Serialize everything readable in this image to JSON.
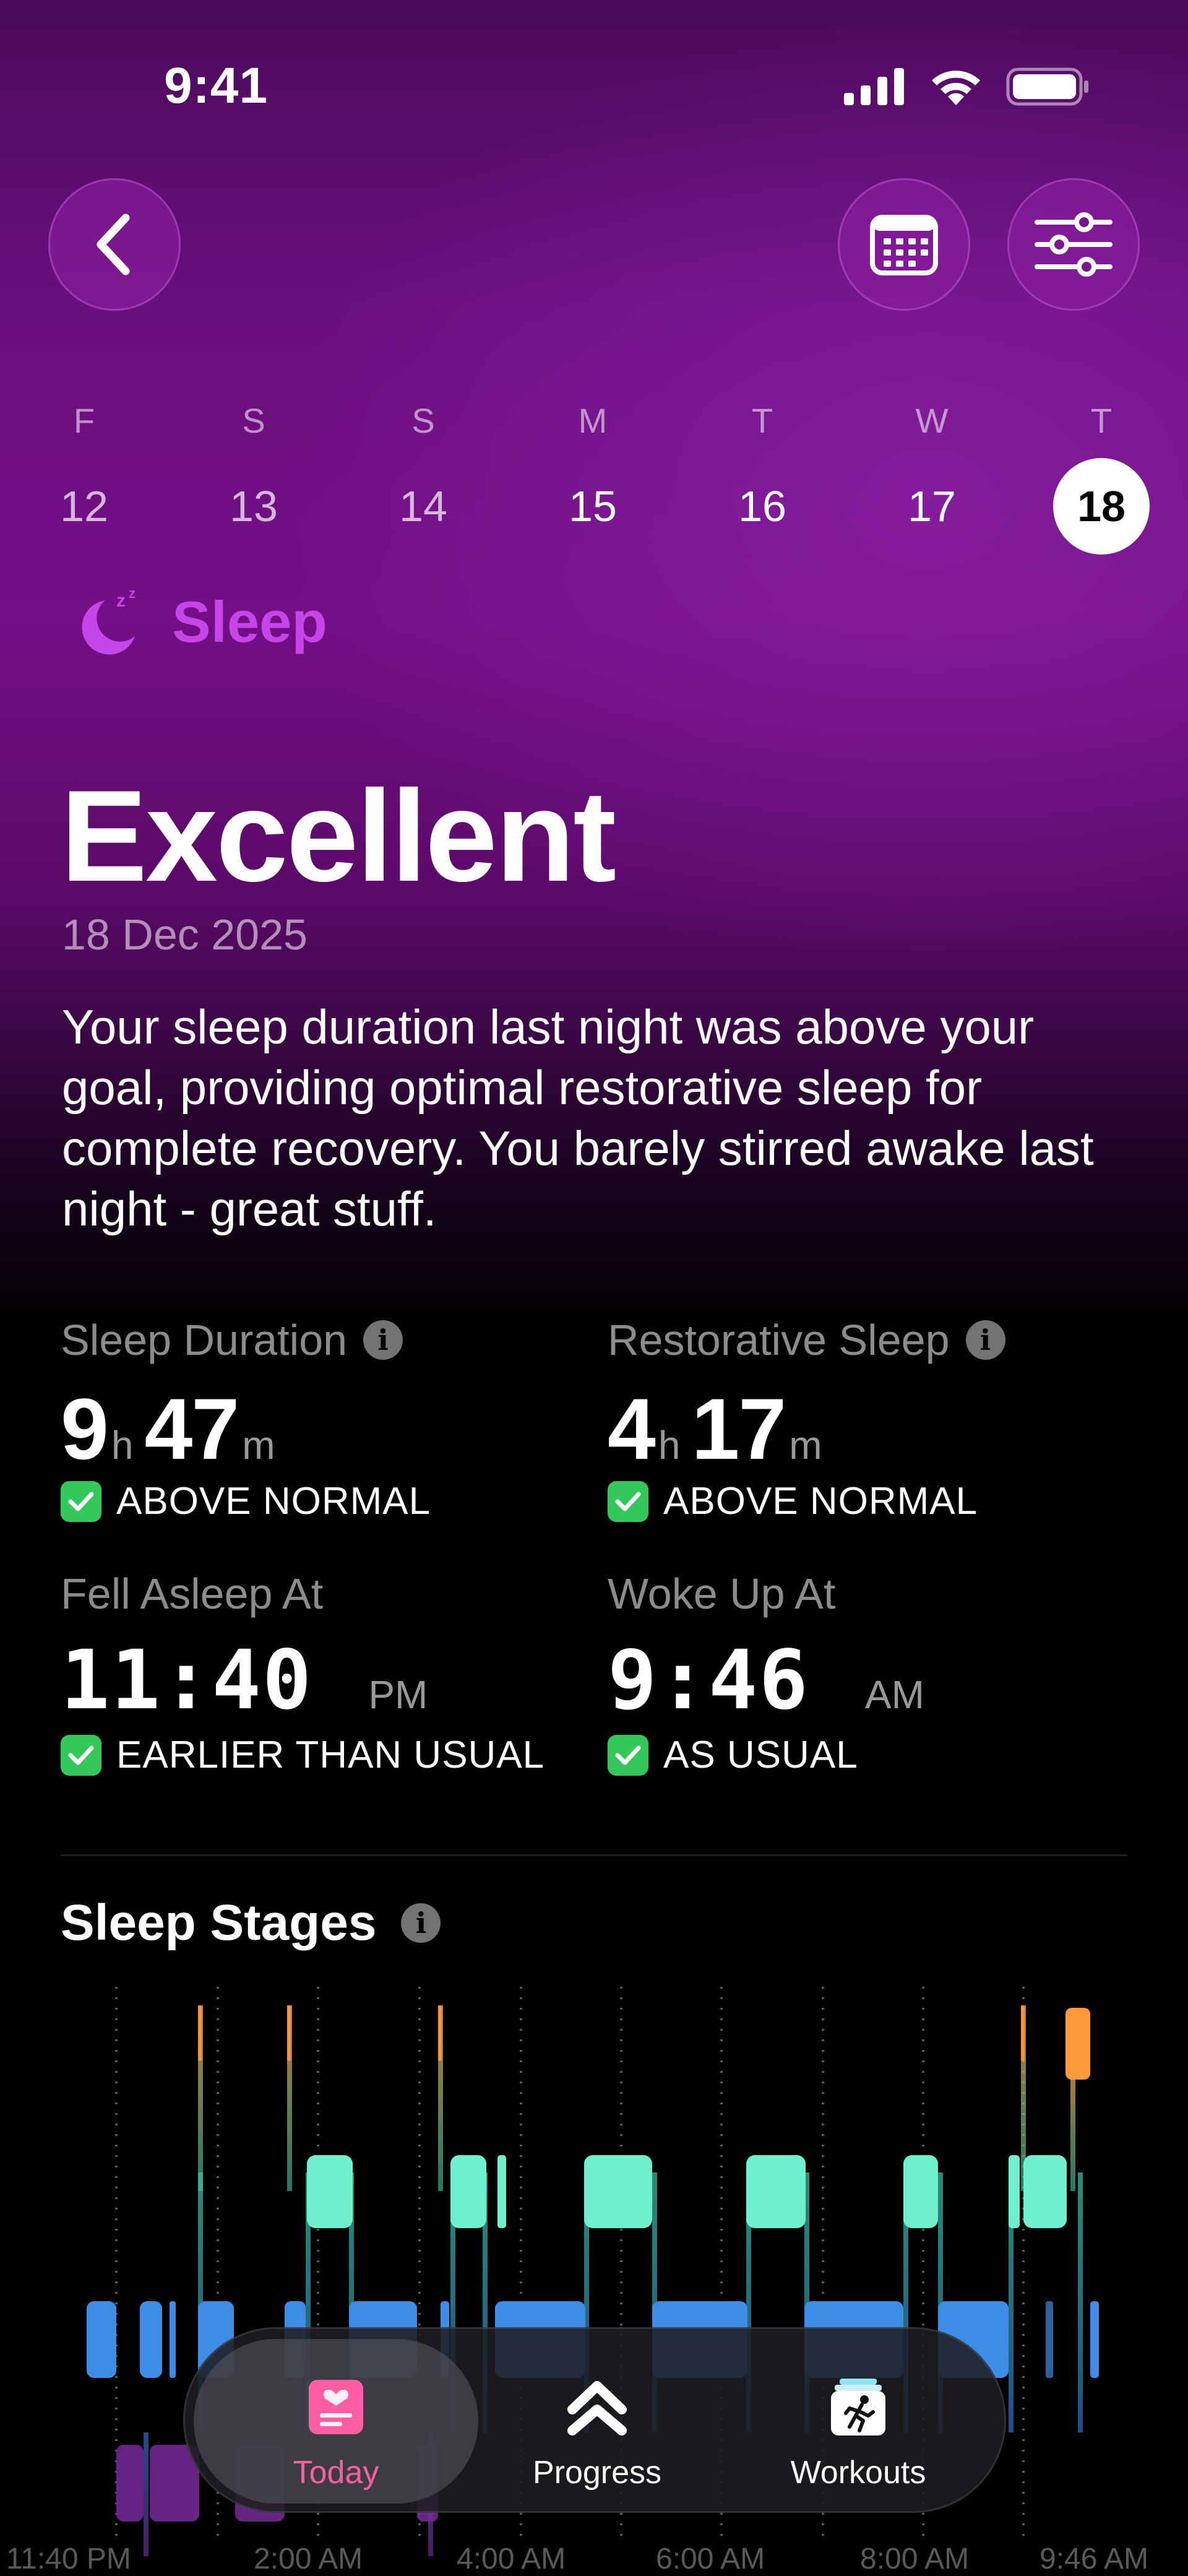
{
  "status_bar": {
    "time": "9:41"
  },
  "week": [
    {
      "letter": "F",
      "number": "12",
      "state": "dim"
    },
    {
      "letter": "S",
      "number": "13",
      "state": "dim"
    },
    {
      "letter": "S",
      "number": "14",
      "state": "dim"
    },
    {
      "letter": "M",
      "number": "15",
      "state": "normal"
    },
    {
      "letter": "T",
      "number": "16",
      "state": "normal"
    },
    {
      "letter": "W",
      "number": "17",
      "state": "normal"
    },
    {
      "letter": "T",
      "number": "18",
      "state": "selected"
    }
  ],
  "category": {
    "label": "Sleep",
    "icon": "moon-zzz-icon",
    "color": "#c545e8"
  },
  "rating": "Excellent",
  "date": "18 Dec 2025",
  "summary": "Your sleep duration last night was above your goal, providing optimal restorative sleep for complete recovery. You barely stirred awake last night - great stuff.",
  "metrics": {
    "duration": {
      "label": "Sleep Duration",
      "hours": "9",
      "h_unit": "h",
      "minutes": "47",
      "m_unit": "m",
      "status": "ABOVE NORMAL"
    },
    "restorative": {
      "label": "Restorative Sleep",
      "hours": "4",
      "h_unit": "h",
      "minutes": "17",
      "m_unit": "m",
      "status": "ABOVE NORMAL"
    },
    "fell_asleep": {
      "label": "Fell Asleep At",
      "time": "11:40",
      "ampm": "PM",
      "status": "EARLIER THAN USUAL"
    },
    "woke_up": {
      "label": "Woke Up At",
      "time": "9:46",
      "ampm": "AM",
      "status": "AS USUAL"
    }
  },
  "stages": {
    "title": "Sleep Stages",
    "axis_labels": [
      "11:40 PM",
      "2:00 AM",
      "4:00 AM",
      "6:00 AM",
      "8:00 AM",
      "9:46 AM"
    ],
    "colors": {
      "awake": "#ff9a3c",
      "rem": "#6ff0cc",
      "core": "#3d8de6",
      "deep": "#7a2a9a"
    }
  },
  "tabs": [
    {
      "label": "Today",
      "icon": "journal-heart-icon",
      "active": true
    },
    {
      "label": "Progress",
      "icon": "chevrons-up-icon",
      "active": false
    },
    {
      "label": "Workouts",
      "icon": "running-figure-icon",
      "active": false
    }
  ]
}
